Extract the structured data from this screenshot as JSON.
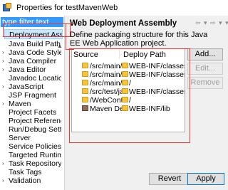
{
  "window": {
    "title": "Properties for testMavenWeb"
  },
  "left_pane": {
    "filter": {
      "placeholder": "type filter text"
    },
    "tree": [
      {
        "label": "Deployment Asse"
      },
      {
        "label": "Java Build Path"
      },
      {
        "label": "Java Code Style"
      },
      {
        "label": "Java Compiler"
      },
      {
        "label": "Java Editor"
      },
      {
        "label": "Javadoc Location"
      },
      {
        "label": "JavaScript"
      },
      {
        "label": "JSP Fragment"
      },
      {
        "label": "Maven"
      },
      {
        "label": "Project Facets"
      },
      {
        "label": "Project Referenc"
      },
      {
        "label": "Run/Debug Setti"
      },
      {
        "label": "Server"
      },
      {
        "label": "Service Policies"
      },
      {
        "label": "Targeted Runtim"
      },
      {
        "label": "Task Repository"
      },
      {
        "label": "Task Tags"
      },
      {
        "label": "Validation"
      }
    ]
  },
  "main": {
    "heading": "Web Deployment Assembly",
    "nav_arrows": "⇦ ▾ ⇨ ▾ ▾",
    "description": "Define packaging structure for this Java EE Web Application project.",
    "table": {
      "columns": [
        "Source",
        "Deploy Path"
      ],
      "rows": [
        {
          "source": "/src/main/co",
          "deploy_path": "WEB-INF/classes",
          "icon": "folder-icon"
        },
        {
          "source": "/src/main/ja",
          "deploy_path": "WEB-INF/classes",
          "icon": "folder-icon"
        },
        {
          "source": "/src/main/we",
          "deploy_path": "/",
          "icon": "folder-icon"
        },
        {
          "source": "/src/test/jav",
          "deploy_path": "WEB-INF/classes",
          "icon": "folder-icon"
        },
        {
          "source": "/WebConten",
          "deploy_path": "/",
          "icon": "folder-icon"
        },
        {
          "source": "Maven Depe",
          "deploy_path": "WEB-INF/lib",
          "icon": "library-icon"
        }
      ]
    },
    "buttons": {
      "add": "Add...",
      "edit": "Edit...",
      "remove": "Remove"
    }
  },
  "footer": {
    "revert": "Revert",
    "apply": "Apply"
  },
  "colors": {
    "highlight": "#e53935",
    "selection": "#cce8ff",
    "filter_selection": "#3399ff"
  }
}
